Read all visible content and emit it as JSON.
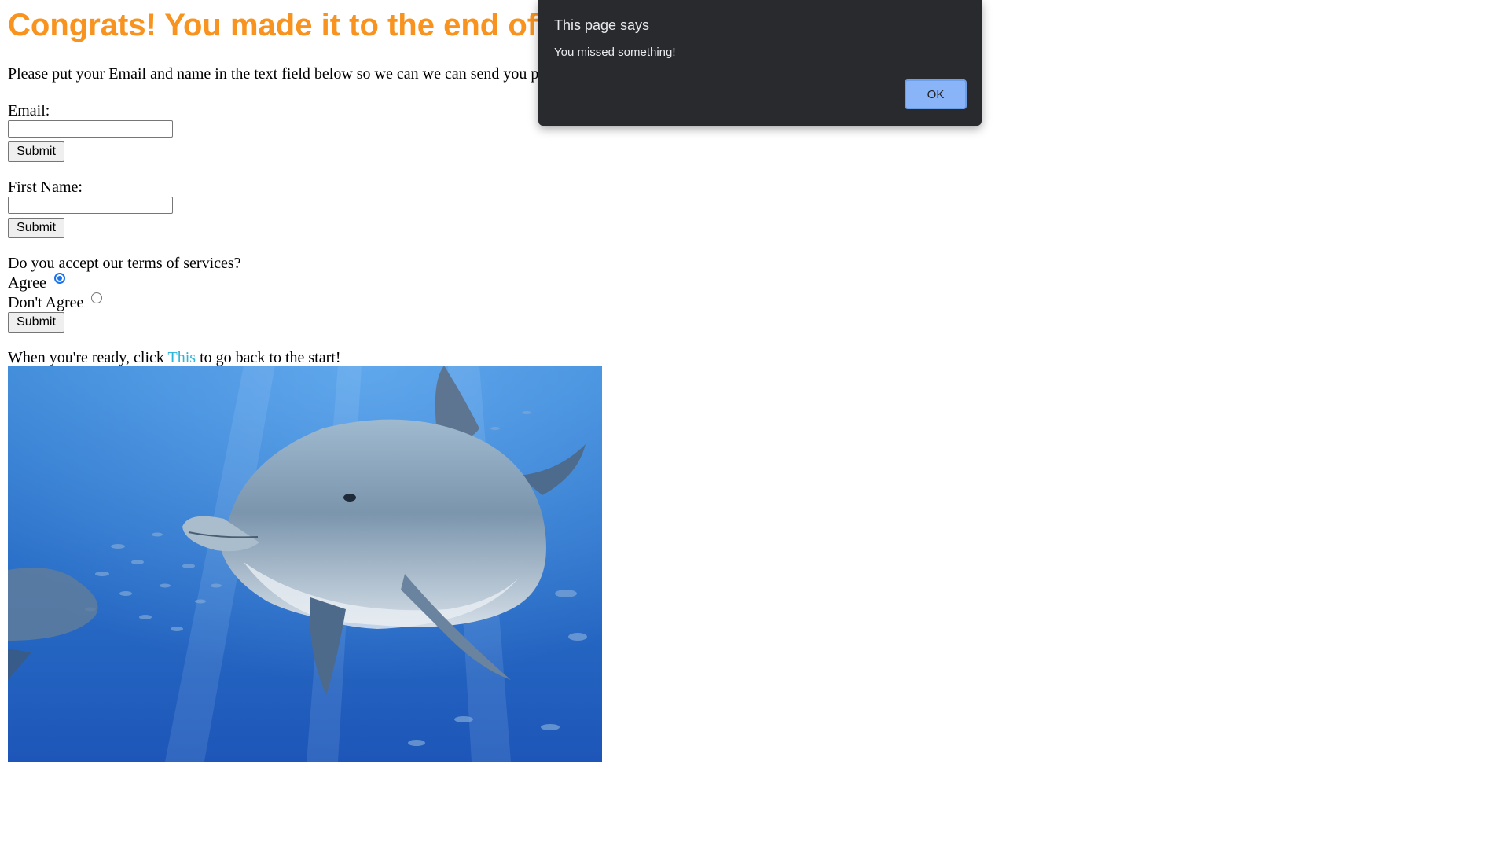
{
  "page": {
    "heading": "Congrats! You made it to the end of",
    "intro": "Please put your Email and name in the text field below so we can we can send you p",
    "email": {
      "label": "Email:",
      "value": "",
      "submit_label": "Submit"
    },
    "first_name": {
      "label": "First Name:",
      "value": "",
      "submit_label": "Submit"
    },
    "terms": {
      "question": "Do you accept our terms of services?",
      "options": [
        {
          "label": "Agree",
          "checked": true
        },
        {
          "label": "Don't Agree",
          "checked": false
        }
      ],
      "submit_label": "Submit"
    },
    "ready": {
      "before": "When you're ready, click ",
      "link": "This",
      "after": " to go back to the start!"
    },
    "image": {
      "subject": "dolphin-underwater"
    }
  },
  "dialog": {
    "title": "This page says",
    "message": "You missed something!",
    "ok_label": "OK"
  },
  "colors": {
    "heading": "#f7931e",
    "link": "#2bb5d8",
    "dialog_bg": "#292a2d",
    "dialog_button": "#8ab4f8",
    "radio_checked": "#1a73e8"
  }
}
